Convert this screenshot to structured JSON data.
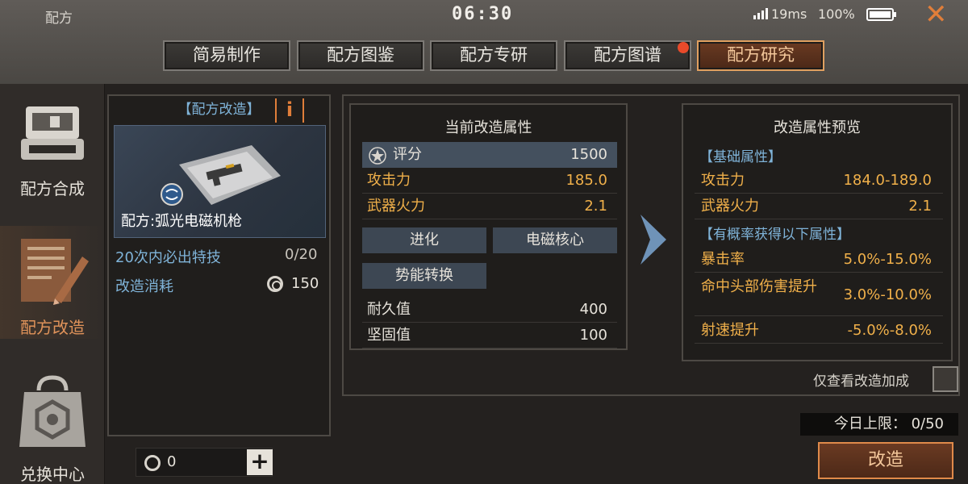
{
  "header": {
    "app_title": "配方",
    "clock": "06:30",
    "ping": "19ms",
    "battery": "100%",
    "close_glyph": "✕"
  },
  "tabs": [
    {
      "label": "简易制作",
      "active": false
    },
    {
      "label": "配方图鉴",
      "active": false
    },
    {
      "label": "配方专研",
      "active": false
    },
    {
      "label": "配方图谱",
      "active": false,
      "badge": true
    },
    {
      "label": "配方研究",
      "active": true
    }
  ],
  "sidebar": {
    "items": [
      {
        "label": "配方合成",
        "icon": "printer-icon",
        "active": false
      },
      {
        "label": "配方改造",
        "icon": "document-pen-icon",
        "active": true
      },
      {
        "label": "兑换中心",
        "icon": "shopping-bag-icon",
        "active": false
      }
    ]
  },
  "recipe_panel": {
    "header": "【配方改造】",
    "info_glyph": "i",
    "recipe_name": "配方:弧光电磁机枪",
    "guarantee_label": "20次内必出特技",
    "guarantee_value": "0/20",
    "cost_label": "改造消耗",
    "cost_value": "150"
  },
  "currency": {
    "value": "0",
    "add_glyph": "+"
  },
  "current_attrs": {
    "title": "当前改造属性",
    "score_label": "评分",
    "score_value": "1500",
    "rows": [
      {
        "label": "攻击力",
        "value": "185.0"
      },
      {
        "label": "武器火力",
        "value": "2.1"
      }
    ],
    "skills": [
      "进化",
      "电磁核心",
      "势能转换"
    ],
    "stats": [
      {
        "label": "耐久值",
        "value": "400"
      },
      {
        "label": "坚固值",
        "value": "100"
      }
    ]
  },
  "preview": {
    "title": "改造属性预览",
    "base_section": "【基础属性】",
    "base_rows": [
      {
        "label": "攻击力",
        "value": "184.0-189.0"
      },
      {
        "label": "武器火力",
        "value": "2.1"
      }
    ],
    "chance_section": "【有概率获得以下属性】",
    "chance_rows": [
      {
        "label": "暴击率",
        "value": "5.0%-15.0%"
      },
      {
        "label": "命中头部伤害提升",
        "value": "3.0%-10.0%"
      },
      {
        "label": "射速提升",
        "value": "-5.0%-8.0%"
      }
    ]
  },
  "footer": {
    "filter_label": "仅查看改造加成",
    "daily_limit": "今日上限： 0/50",
    "modify_button": "改造"
  },
  "colors": {
    "accent_orange": "#e07e3a",
    "value_gold": "#f0b04a",
    "label_blue": "#7fb3d8",
    "highlight_row": "#44505e"
  }
}
